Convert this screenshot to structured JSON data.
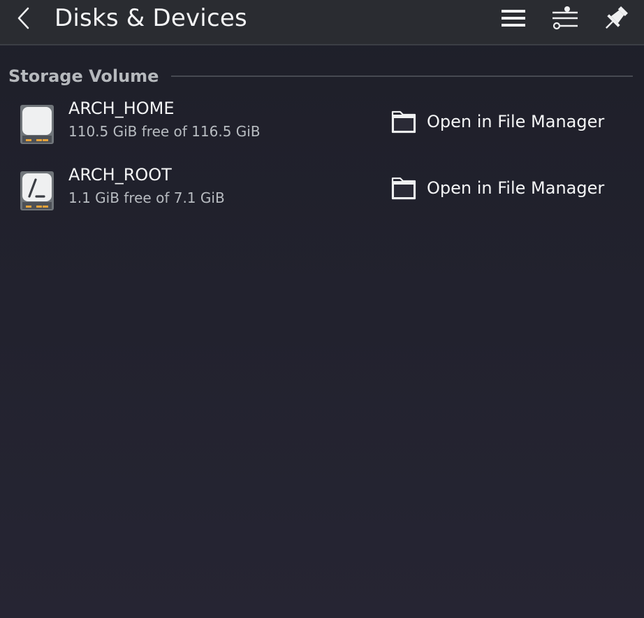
{
  "header": {
    "title": "Disks & Devices",
    "icons": {
      "back": "chevron-left-icon",
      "menu": "hamburger-menu-icon",
      "configure": "sliders-icon",
      "pin": "pin-icon"
    }
  },
  "section": {
    "title": "Storage Volume"
  },
  "volumes": [
    {
      "name": "ARCH_HOME",
      "info": "110.5 GiB free of 116.5 GiB",
      "icon": "drive-harddisk-icon",
      "action_label": "Open in File Manager"
    },
    {
      "name": "ARCH_ROOT",
      "info": "1.1 GiB free of 7.1 GiB",
      "icon": "drive-root-icon",
      "action_label": "Open in File Manager"
    }
  ],
  "colors": {
    "background": "#22222e",
    "header": "#2a2c31",
    "text": "#f4f5f6",
    "secondary_text": "#b8bcc1"
  }
}
